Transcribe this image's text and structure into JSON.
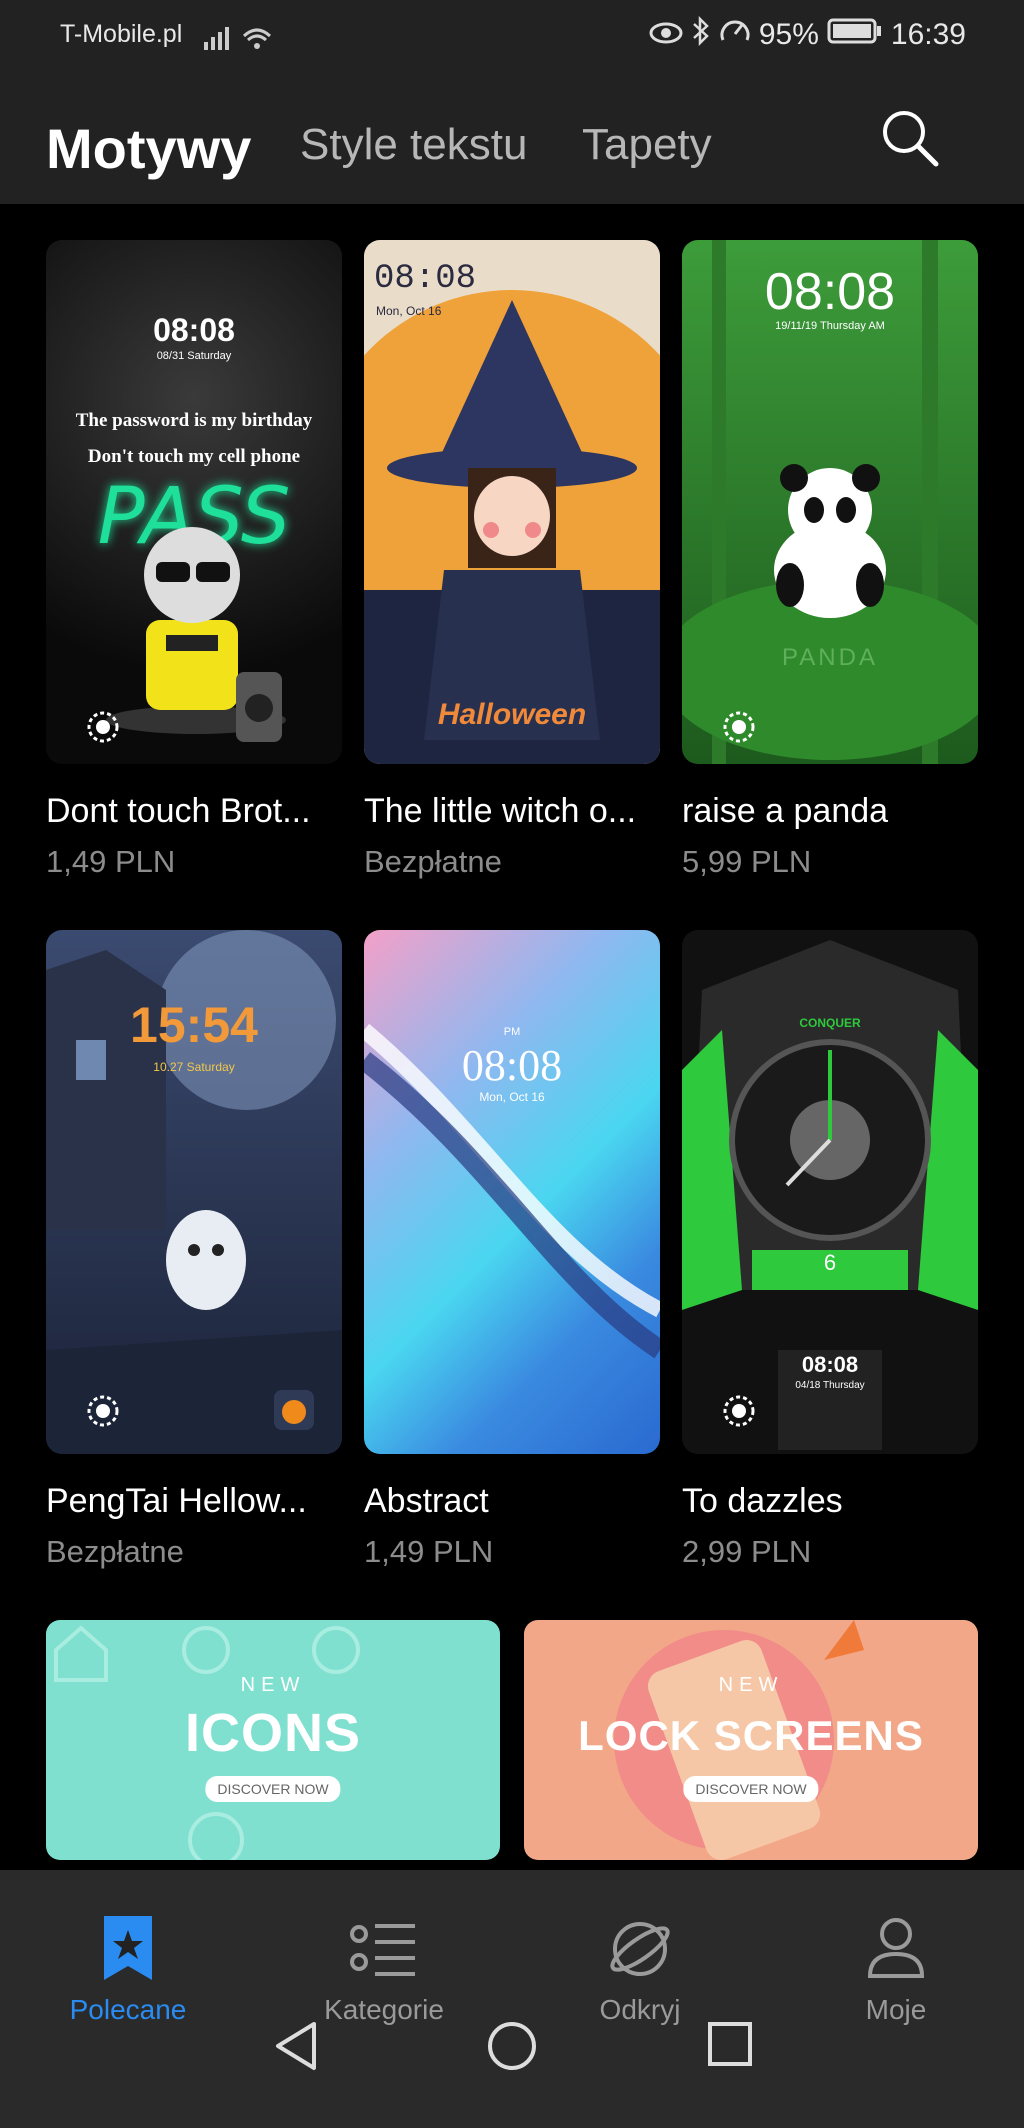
{
  "status_bar": {
    "carrier": "T-Mobile.pl",
    "battery": "95%",
    "time": "16:39"
  },
  "header": {
    "tabs": [
      {
        "label": "Motywy",
        "active": true
      },
      {
        "label": "Style tekstu",
        "active": false
      },
      {
        "label": "Tapety",
        "active": false
      }
    ]
  },
  "themes": [
    {
      "title": "Dont touch Brot...",
      "price": "1,49 PLN",
      "clock": "08:08",
      "date": "08/31 Saturday",
      "line1": "The password is my birthday",
      "line2": "Don't touch my cell phone",
      "neon": "PASS"
    },
    {
      "title": "The little witch o...",
      "price": "Bezpłatne",
      "clock": "08:08",
      "date": "Mon, Oct 16",
      "caption": "Halloween"
    },
    {
      "title": "raise a panda",
      "price": "5,99 PLN",
      "clock": "08:08",
      "date": "19/11/19 Thursday AM",
      "caption": "PANDA"
    },
    {
      "title": "PengTai Hellow...",
      "price": "Bezpłatne",
      "clock": "15:54",
      "date": "10.27 Saturday"
    },
    {
      "title": "Abstract",
      "price": "1,49 PLN",
      "clock": "08:08",
      "date": "Mon, Oct 16",
      "ampm": "PM"
    },
    {
      "title": "To dazzles",
      "price": "2,99 PLN",
      "clock": "08:08",
      "date": "04/18 Thursday",
      "brand": "CONQUER",
      "dial": "6"
    }
  ],
  "banners": [
    {
      "new": "NEW",
      "title": "ICONS",
      "cta": "DISCOVER NOW",
      "color": "#7fe0cf"
    },
    {
      "new": "NEW",
      "title": "LOCK SCREENS",
      "cta": "DISCOVER NOW",
      "color": "#f2a888"
    }
  ],
  "bottom_nav": [
    {
      "label": "Polecane",
      "icon": "bookmark-star-icon",
      "active": true
    },
    {
      "label": "Kategorie",
      "icon": "list-icon",
      "active": false
    },
    {
      "label": "Odkryj",
      "icon": "planet-icon",
      "active": false
    },
    {
      "label": "Moje",
      "icon": "person-icon",
      "active": false
    }
  ],
  "colors": {
    "accent": "#2a8cf0",
    "bar": "#222222",
    "price": "#8c8c8c"
  }
}
